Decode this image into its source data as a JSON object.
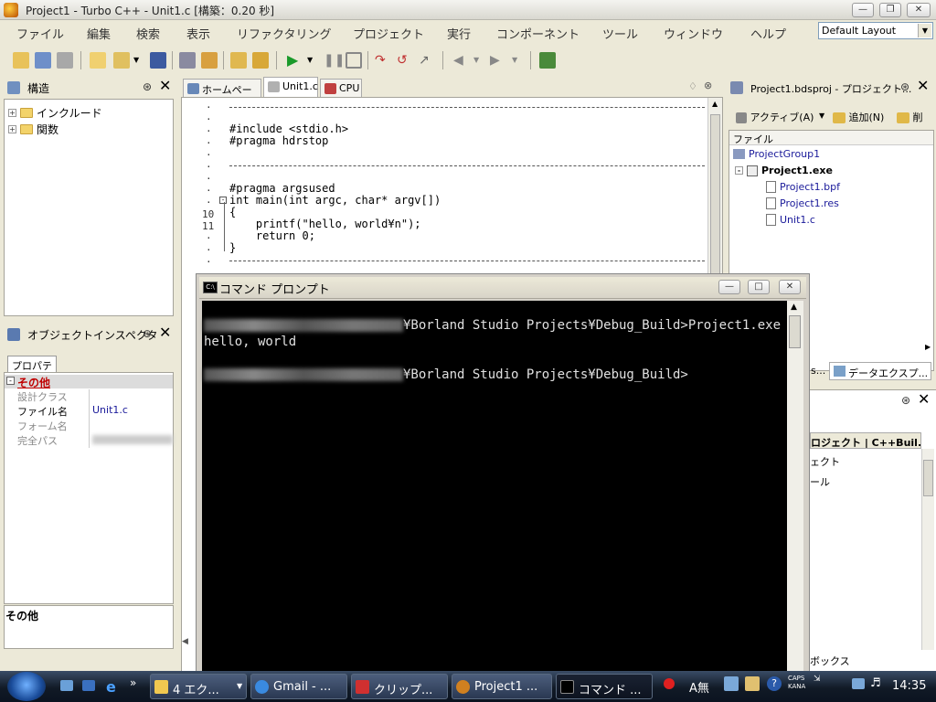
{
  "titlebar": {
    "title": "Project1 - Turbo C++ - Unit1.c [構築：0.20 秒]"
  },
  "menubar": {
    "items": [
      "ファイル",
      "編集",
      "検索",
      "表示",
      "リファクタリング",
      "プロジェクト",
      "実行",
      "コンポーネント",
      "ツール",
      "ウィンドウ",
      "ヘルプ"
    ],
    "layout_value": "Default Layout"
  },
  "structure": {
    "title": "構造",
    "items": [
      "インクルード",
      "関数"
    ]
  },
  "inspector": {
    "title": "オブジェクトインスペクタ",
    "tab": "プロパティ",
    "category": "その他",
    "props": [
      {
        "name": "設計クラス",
        "value": ""
      },
      {
        "name": "ファイル名",
        "value": "Unit1.c"
      },
      {
        "name": "フォーム名",
        "value": ""
      },
      {
        "name": "完全パス",
        "value": ""
      }
    ],
    "footer": "その他"
  },
  "editor": {
    "tabs": [
      "ホームページ",
      "Unit1.c",
      "CPU"
    ],
    "lines": [
      {
        "gutter": "·",
        "code": "//---------------------------------------------------------------------------"
      },
      {
        "gutter": "·",
        "code": ""
      },
      {
        "gutter": "·",
        "code": "#include <stdio.h>"
      },
      {
        "gutter": "·",
        "code": "#pragma hdrstop"
      },
      {
        "gutter": "·",
        "code": ""
      },
      {
        "gutter": "·",
        "code": "//---------------------------------------------------------------------------"
      },
      {
        "gutter": "·",
        "code": ""
      },
      {
        "gutter": "·",
        "code": "#pragma argsused"
      },
      {
        "gutter": "·",
        "code": "int main(int argc, char* argv[])"
      },
      {
        "gutter": "10",
        "code": "{"
      },
      {
        "gutter": "11",
        "code": "    printf(\"hello, world¥n\");"
      },
      {
        "gutter": "·",
        "code": "    return 0;"
      },
      {
        "gutter": "·",
        "code": "}"
      },
      {
        "gutter": "·",
        "code": "//---------------------------------------------------------------------------"
      }
    ]
  },
  "project": {
    "title": "Project1.bdsproj - プロジェクト...",
    "activate": "アクティブ(A)",
    "add": "追加(N)",
    "remove": "削",
    "column": "ファイル",
    "group": "ProjectGroup1",
    "project": "Project1.exe",
    "files": [
      "Project1.bpf",
      "Project1.res",
      "Unit1.c"
    ],
    "bottom_tabs": [
      "s...",
      "データエクスプ..."
    ]
  },
  "palette": {
    "header": "ロジェクト | C++Buil...",
    "items": [
      "ェクト",
      "ール"
    ],
    "footer": "ボックス"
  },
  "cmd": {
    "title": "コマンド プロンプト",
    "path": "¥Borland Studio Projects¥Debug_Build>",
    "command": "Project1.exe",
    "output": "hello, world"
  },
  "taskbar": {
    "tasks": [
      "4 エク...",
      "Gmail - ...",
      "クリップ...",
      "Project1 ...",
      "コマンド ..."
    ],
    "clock": "14:35",
    "caps": "CAPS",
    "kana": "KANA"
  }
}
